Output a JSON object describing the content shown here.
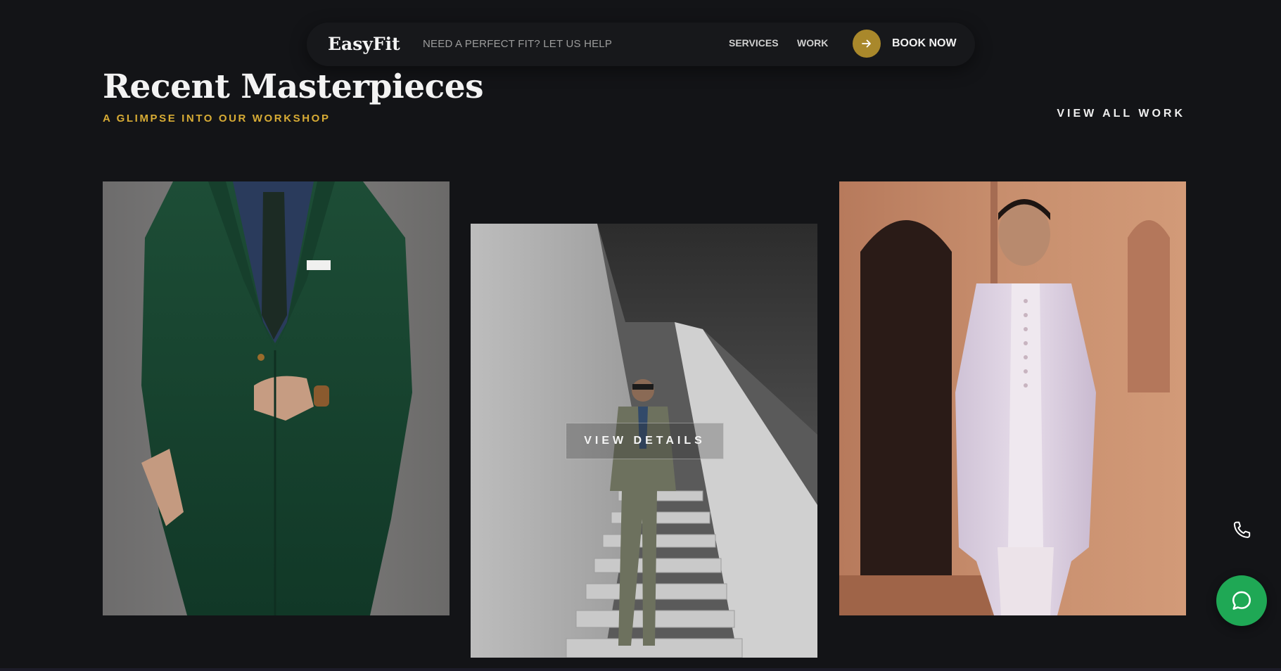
{
  "nav": {
    "brand": "EasyFit",
    "tagline": "NEED A PERFECT FIT? LET US HELP",
    "links": [
      {
        "label": "SERVICES"
      },
      {
        "label": "WORK"
      }
    ],
    "cta": {
      "label": "BOOK NOW",
      "icon": "arrow-right-icon"
    }
  },
  "section": {
    "title": "Recent Masterpieces",
    "subtitle": "A GLIMPSE INTO OUR WORKSHOP",
    "view_all": "VIEW ALL WORK"
  },
  "cards": [
    {
      "image": "green-suit-photo"
    },
    {
      "image": "olive-suit-staircase-photo",
      "overlay_label": "VIEW DETAILS"
    },
    {
      "image": "embroidered-sherwani-photo"
    }
  ],
  "floating": {
    "phone_icon": "phone-icon",
    "chat_icon": "chat-bubble-icon"
  },
  "colors": {
    "background": "#131417",
    "accent_gold": "#d8ac35",
    "cta_circle": "#a9882b",
    "chat_green": "#1fa855"
  }
}
